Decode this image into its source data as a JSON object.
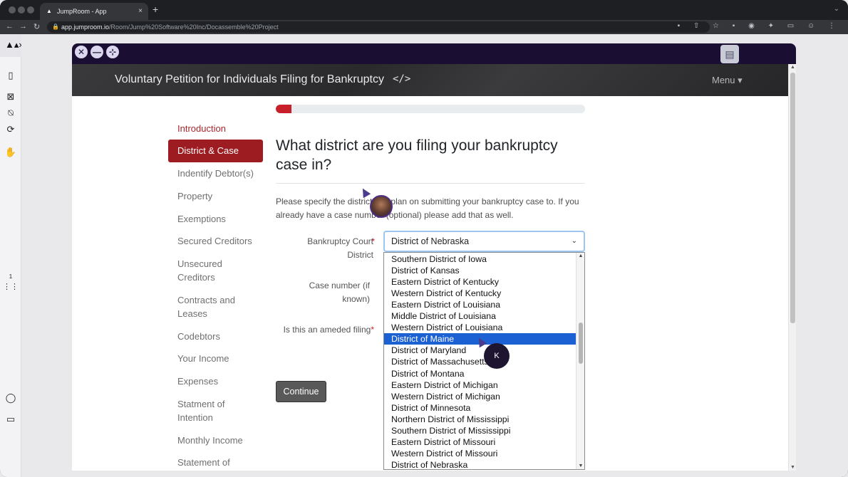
{
  "browser": {
    "tab_title": "JumpRoom - App",
    "new_tab": "+",
    "close_tab": "×",
    "url_host": "app.jumproom.io",
    "url_path": "/Room/Jump%20Software%20Inc/Docassemble%20Project"
  },
  "rail": {
    "page_counter": "1"
  },
  "header": {
    "title": "Voluntary Petition for Individuals Filing for Bankruptcy",
    "code_icon": "</>",
    "menu": "Menu ▾"
  },
  "nav": {
    "items": [
      "Introduction",
      "District & Case",
      "Indentify Debtor(s)",
      "Property",
      "Exemptions",
      "Secured Creditors",
      "Unsecured Creditors",
      "Contracts and Leases",
      "Codebtors",
      "Your Income",
      "Expenses",
      "Statment of Intention",
      "Monthly Income",
      "Statement of"
    ]
  },
  "progress": {
    "percent": 5
  },
  "main": {
    "question": "What district are you filing your bankruptcy case in?",
    "description": "Please specify the district you plan on submitting your bankruptcy case to. If you already have a case number (optional) please add that as well.",
    "fields": {
      "court_label": "Bankruptcy Court District",
      "case_label": "Case number (if known)",
      "amended_label": "Is this an ameded filing",
      "required_mark": "*"
    },
    "select_value": "District of Nebraska",
    "options": [
      "Southern District of Iowa",
      "District of Kansas",
      "Eastern District of Kentucky",
      "Western District of Kentucky",
      "Eastern District of Louisiana",
      "Middle District of Louisiana",
      "Western District of Louisiana",
      "District of Maine",
      "District of Maryland",
      "District of Massachusetts",
      "District of Montana",
      "Eastern District of Michigan",
      "Western District of Michigan",
      "District of Minnesota",
      "Northern District of Mississippi",
      "Southern District of Mississippi",
      "Eastern District of Missouri",
      "Western District of Missouri",
      "District of Nebraska"
    ],
    "highlighted_option": "District of Maine",
    "continue_label": "Continue"
  },
  "overlay": {
    "participant_initial": "K"
  }
}
